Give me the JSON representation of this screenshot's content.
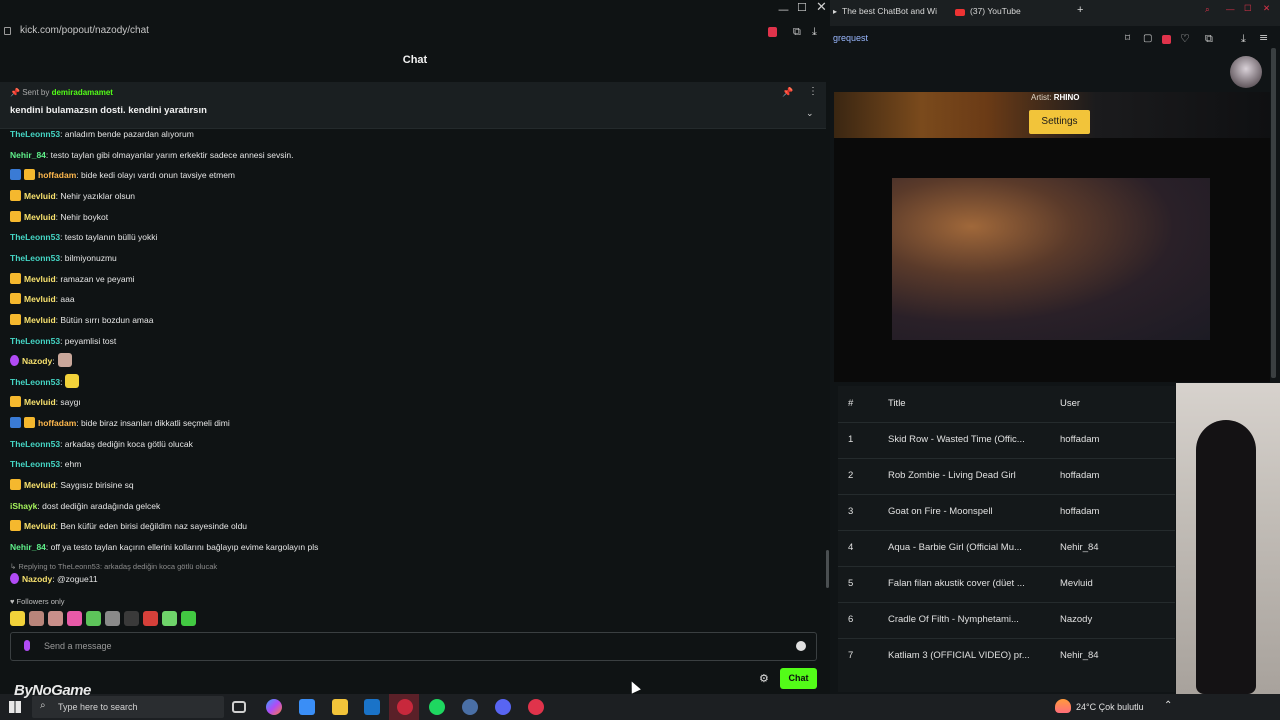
{
  "left_window": {
    "url": "kick.com/popout/nazody/chat",
    "chat_title": "Chat",
    "pinned": {
      "sent_by_prefix": "Sent by",
      "sent_by_user": "demiradamamet",
      "text": "kendini bulamazsın dosti. kendini yaratırsın"
    },
    "messages": [
      {
        "badges": [],
        "user": "TheLeonn53",
        "color": "teal",
        "text": ": anladım bende pazardan alıyorum"
      },
      {
        "badges": [],
        "user": "Nehir_84",
        "color": "green",
        "text": ": testo taylan gibi olmayanlar yarım erkektir sadece annesi sevsin."
      },
      {
        "badges": [
          "mod",
          "crown"
        ],
        "user": "hoffadam",
        "color": "orange",
        "text": ": bide kedi olayı vardı onun tavsiye etmem"
      },
      {
        "badges": [
          "crown"
        ],
        "user": "Mevluid",
        "color": "yellow",
        "text": ": Nehir yazıklar olsun"
      },
      {
        "badges": [
          "crown"
        ],
        "user": "Mevluid",
        "color": "yellow",
        "text": ": Nehir boykot"
      },
      {
        "badges": [],
        "user": "TheLeonn53",
        "color": "teal",
        "text": ": testo taylanın büllü yokki"
      },
      {
        "badges": [],
        "user": "TheLeonn53",
        "color": "teal",
        "text": ": bilmiyonuzmu"
      },
      {
        "badges": [
          "crown"
        ],
        "user": "Mevluid",
        "color": "yellow",
        "text": ": ramazan ve peyami"
      },
      {
        "badges": [
          "crown"
        ],
        "user": "Mevluid",
        "color": "yellow",
        "text": ": aaa"
      },
      {
        "badges": [
          "crown"
        ],
        "user": "Mevluid",
        "color": "yellow",
        "text": ": Bütün sırrı bozdun amaa"
      },
      {
        "badges": [],
        "user": "TheLeonn53",
        "color": "teal",
        "text": ": peyamlisi tost"
      },
      {
        "badges": [
          "mic"
        ],
        "user": "Nazody",
        "color": "yellow",
        "text": ":",
        "emote": "#c9a79a"
      },
      {
        "badges": [],
        "user": "TheLeonn53",
        "color": "teal",
        "text": ":",
        "emote": "#f2d23a"
      },
      {
        "badges": [
          "crown"
        ],
        "user": "Mevluid",
        "color": "yellow",
        "text": ": saygı"
      },
      {
        "badges": [
          "mod",
          "crown"
        ],
        "user": "hoffadam",
        "color": "orange",
        "text": ": bide biraz insanları dikkatli seçmeli dimi"
      },
      {
        "badges": [],
        "user": "TheLeonn53",
        "color": "teal",
        "text": ": arkadaş dediğin koca götlü olucak"
      },
      {
        "badges": [],
        "user": "TheLeonn53",
        "color": "teal",
        "text": ": ehm"
      },
      {
        "badges": [
          "crown"
        ],
        "user": "Mevluid",
        "color": "yellow",
        "text": ": Saygısız birisine sq"
      },
      {
        "badges": [],
        "user": "iShayk",
        "color": "lime",
        "text": ": dost dediğin aradağında gelcek"
      },
      {
        "badges": [
          "crown"
        ],
        "user": "Mevluid",
        "color": "yellow",
        "text": ": Ben küfür eden birisi değildim naz sayesinde oldu"
      },
      {
        "badges": [],
        "user": "Nehir_84",
        "color": "green",
        "text": ": off ya testo taylan kaçırın ellerini kollarını bağlayıp evime kargolayın pls"
      }
    ],
    "reply_hint": "Replying to TheLeonn53: arkadaş dediğin koca götlü olucak",
    "reply_message": {
      "user": "Nazody",
      "text": ": @zogue11"
    },
    "followers_only": "Followers only",
    "input_placeholder": "Send a message",
    "chat_button": "Chat",
    "overlay_logo": "ByNoGame"
  },
  "right_window": {
    "tabs": [
      "The best ChatBot and Wi",
      "(37) YouTube"
    ],
    "address": "grequest",
    "artist_label": "Artist:",
    "artist_name": "RHINO",
    "settings_button": "Settings",
    "queue_headers": {
      "num": "#",
      "title": "Title",
      "user": "User"
    },
    "queue": [
      {
        "num": "1",
        "title": "Skid Row - Wasted Time (Offic...",
        "user": "hoffadam"
      },
      {
        "num": "2",
        "title": "Rob Zombie - Living Dead Girl",
        "user": "hoffadam"
      },
      {
        "num": "3",
        "title": "Goat on Fire - Moonspell",
        "user": "hoffadam"
      },
      {
        "num": "4",
        "title": "Aqua - Barbie Girl (Official Mu...",
        "user": "Nehir_84"
      },
      {
        "num": "5",
        "title": "Falan filan akustik cover (düet ...",
        "user": "Mevluid"
      },
      {
        "num": "6",
        "title": "Cradle Of Filth - Nymphetami...",
        "user": "Nazody"
      },
      {
        "num": "7",
        "title": "Katliam 3 (OFFICIAL VIDEO) pr...",
        "user": "Nehir_84"
      }
    ]
  },
  "taskbar": {
    "search_placeholder": "Type here to search",
    "weather": "24°C  Çok bulutlu",
    "colors": {
      "kick_green": "#53fc18",
      "settings_yellow": "#f2c43a"
    }
  }
}
